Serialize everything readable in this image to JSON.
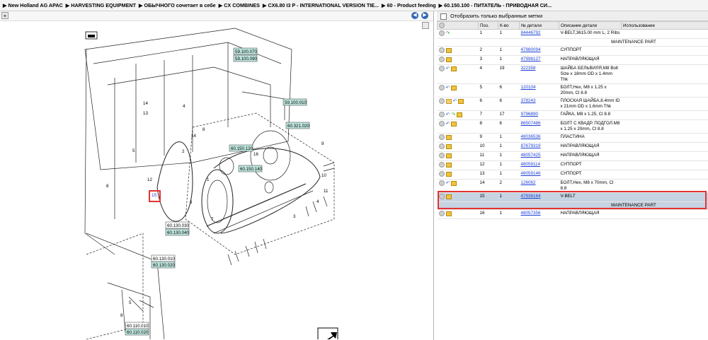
{
  "breadcrumb": [
    "▶ New Holland AG APAC",
    "▶ HARVESTING EQUIPMENT",
    "▶ ОБЫЧНОГО сочетает в себе",
    "▶ CX COMBINES",
    "▶ CX6.80 I3 P - INTERNATIONAL VERSION TIE...",
    "▶ 60 - Product feeding",
    "▶ 60.150.100 - ПИТАТЕЛЬ - ПРИВОДНАЯ СИ..."
  ],
  "filter_label": "Отобразить только выбранные метки",
  "table": {
    "headers": [
      "",
      "Поз.",
      "К-во",
      "№ детали",
      "Описание детали",
      "Использование"
    ],
    "rows": [
      {
        "icons": [
          "circle-icon",
          "forward-arrow-icon"
        ],
        "pos": "1",
        "qty": "1",
        "part": "84446792",
        "desc": "V-BELT,3615.00 mm L, 2 Ribs",
        "use": "",
        "maintenance": "MAINTENANCE PART"
      },
      {
        "icons": [
          "circle-icon",
          "box-icon"
        ],
        "pos": "2",
        "qty": "1",
        "part": "47980094",
        "desc": "СУППОРТ",
        "use": ""
      },
      {
        "icons": [
          "circle-icon",
          "box-icon"
        ],
        "pos": "3",
        "qty": "1",
        "part": "47998127",
        "desc": "НАПРАВЛЯЮЩАЯ",
        "use": ""
      },
      {
        "icons": [
          "circle-icon",
          "back-arrow-icon",
          "box-icon"
        ],
        "pos": "4",
        "qty": "19",
        "part": "322358",
        "desc": "ШАЙБА БЕЛЬВИЛЯ,M8 Bolt Size x 18mm OD x 1.4mm Thk",
        "use": ""
      },
      {
        "icons": [
          "circle-icon",
          "back-arrow-icon",
          "box-icon"
        ],
        "pos": "5",
        "qty": "6",
        "part": "120104",
        "desc": "БОЛТ,Hex, M8 x 1.25 x 20mm, Cl 8.8",
        "use": ""
      },
      {
        "icons": [
          "circle-icon",
          "folder-icon",
          "back-arrow-icon",
          "box-icon"
        ],
        "pos": "6",
        "qty": "6",
        "part": "378243",
        "desc": "ПЛОСКАЯ ШАЙБА,8.4mm ID x 21mm OD x 1.6mm Thk",
        "use": ""
      },
      {
        "icons": [
          "circle-icon",
          "back-arrow-icon",
          "forward-arrow-icon",
          "box-icon"
        ],
        "pos": "7",
        "qty": "17",
        "part": "9796890",
        "desc": "ГАЙКА, M8 x 1.25, Cl 8.8",
        "use": ""
      },
      {
        "icons": [
          "circle-icon",
          "back-arrow-icon",
          "box-icon"
        ],
        "pos": "8",
        "qty": "6",
        "part": "86507486",
        "desc": "БОЛТ С КВАДР. ПОДГОЛ.M8 x 1.25 x 20mm, Cl 8.8",
        "use": ""
      },
      {
        "icons": [
          "circle-icon",
          "box-icon"
        ],
        "pos": "9",
        "qty": "1",
        "part": "48036536",
        "desc": "ПЛАСТИНА",
        "use": ""
      },
      {
        "icons": [
          "circle-icon",
          "box-icon"
        ],
        "pos": "10",
        "qty": "1",
        "part": "87679319",
        "desc": "НАПРАВЛЯЮЩАЯ",
        "use": ""
      },
      {
        "icons": [
          "circle-icon",
          "box-icon"
        ],
        "pos": "11",
        "qty": "1",
        "part": "48057425",
        "desc": "НАПРАВЛЯЮЩАЯ",
        "use": ""
      },
      {
        "icons": [
          "circle-icon",
          "box-icon"
        ],
        "pos": "12",
        "qty": "1",
        "part": "48059114",
        "desc": "СУППОРТ",
        "use": ""
      },
      {
        "icons": [
          "circle-icon",
          "box-icon"
        ],
        "pos": "13",
        "qty": "1",
        "part": "48059146",
        "desc": "СУППОРТ",
        "use": ""
      },
      {
        "icons": [
          "circle-icon",
          "back-arrow-icon",
          "box-icon"
        ],
        "pos": "14",
        "qty": "2",
        "part": "126062",
        "desc": "БОЛТ,Hex, M8 x 70mm, Cl 8.8",
        "use": ""
      },
      {
        "icons": [
          "circle-icon",
          "box-icon"
        ],
        "pos": "15",
        "qty": "1",
        "part": "47936164",
        "desc": "V-BELT",
        "use": "",
        "maintenance": "MAINTENANCE PART",
        "selected": true
      },
      {
        "icons": [
          "circle-icon",
          "box-icon"
        ],
        "pos": "16",
        "qty": "1",
        "part": "48057356",
        "desc": "НАПРАВЛЯЮЩАЯ",
        "use": ""
      }
    ]
  },
  "diagram": {
    "refs_green": [
      "59.100.070",
      "59.100.090",
      "59.100.010",
      "60.321.020",
      "60.150.120",
      "60.150.140",
      "60.130.040",
      "60.130.020",
      "60.110.020"
    ],
    "refs_plain": [
      "60.130.030",
      "60.130.010",
      "60.110.010"
    ],
    "highlighted_callout": "15",
    "callouts": [
      "14",
      "13",
      "8",
      "12",
      "4",
      "5",
      "8",
      "14",
      "2",
      "1",
      "6",
      "7",
      "9",
      "10",
      "11",
      "4",
      "3",
      "16",
      "8",
      "5"
    ]
  },
  "colors": {
    "selection_border": "#e23333",
    "selected_row": "#c6d3e2",
    "ref_fill": "#bfe7df",
    "link": "#1a3fd6"
  }
}
